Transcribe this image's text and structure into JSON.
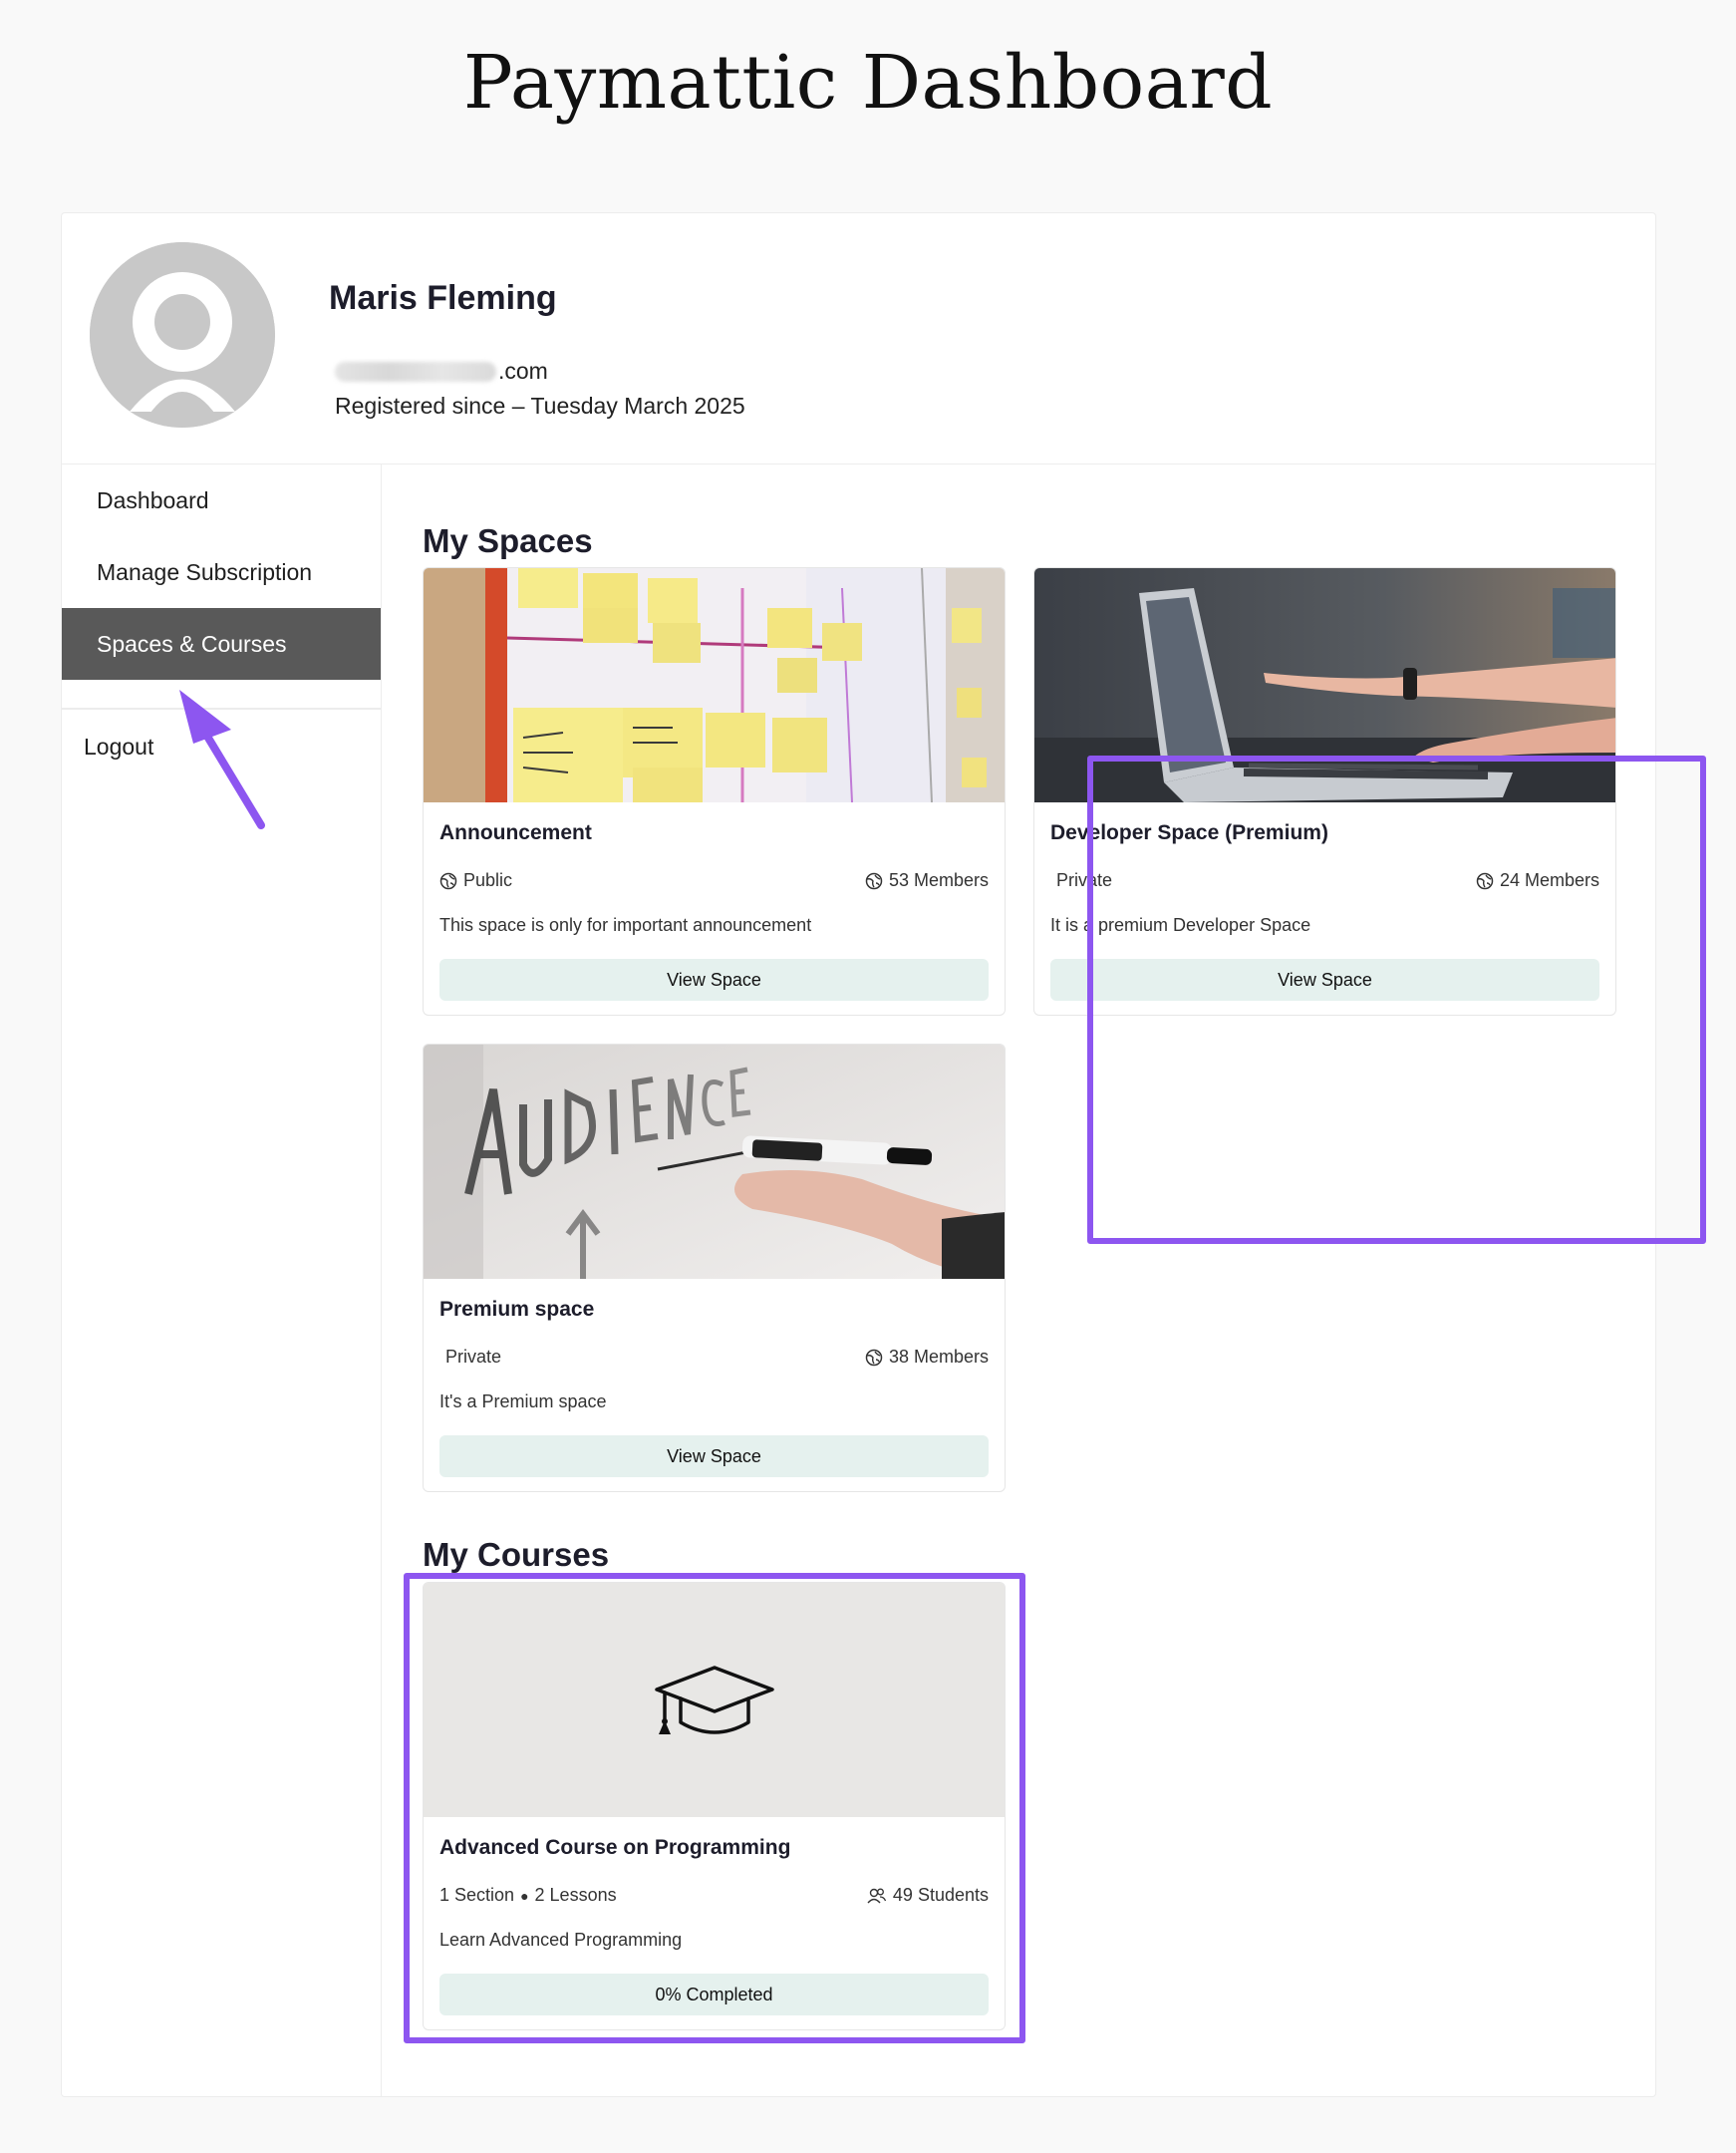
{
  "page": {
    "title": "Paymattic Dashboard"
  },
  "profile": {
    "name": "Maris Fleming",
    "email_visible": ".com",
    "registered": "Registered since – Tuesday March 2025",
    "avatar_icon": "user-avatar-placeholder-icon"
  },
  "sidebar": {
    "items": [
      {
        "label": "Dashboard",
        "active": false
      },
      {
        "label": "Manage Subscription",
        "active": false
      },
      {
        "label": "Spaces & Courses",
        "active": true
      },
      {
        "label": "Logout",
        "active": false
      }
    ]
  },
  "spaces": {
    "heading": "My Spaces",
    "cards": [
      {
        "title": "Announcement",
        "visibility": "Public",
        "visibility_icon": "globe-icon",
        "members": "53 Members",
        "members_icon": "globe-icon",
        "description": "This space is only for important announcement",
        "button": "View Space",
        "image": "sticky-notes-whiteboard-photo"
      },
      {
        "title": "Developer Space (Premium)",
        "visibility": "Private",
        "members": "24 Members",
        "members_icon": "globe-icon",
        "description": "It is a premium Developer Space",
        "button": "View Space",
        "image": "laptop-hands-photo",
        "highlighted": true
      },
      {
        "title": "Premium space",
        "visibility": "Private",
        "members": "38 Members",
        "members_icon": "globe-icon",
        "description": "It's a Premium space",
        "button": "View Space",
        "image": "audience-whiteboard-marker-photo"
      }
    ]
  },
  "courses": {
    "heading": "My Courses",
    "cards": [
      {
        "title": "Advanced Course on Programming",
        "sections": "1 Section",
        "lessons": "2 Lessons",
        "students": "49 Students",
        "students_icon": "users-icon",
        "description": "Learn Advanced Programming",
        "progress_label": "0% Completed",
        "progress": 0,
        "image_icon": "graduation-cap-icon",
        "highlighted": true
      }
    ]
  },
  "colors": {
    "highlight": "#8d56f0",
    "active_nav": "#595959",
    "button_bg": "#e5f1ee",
    "page_bg": "#f9f9f9"
  }
}
